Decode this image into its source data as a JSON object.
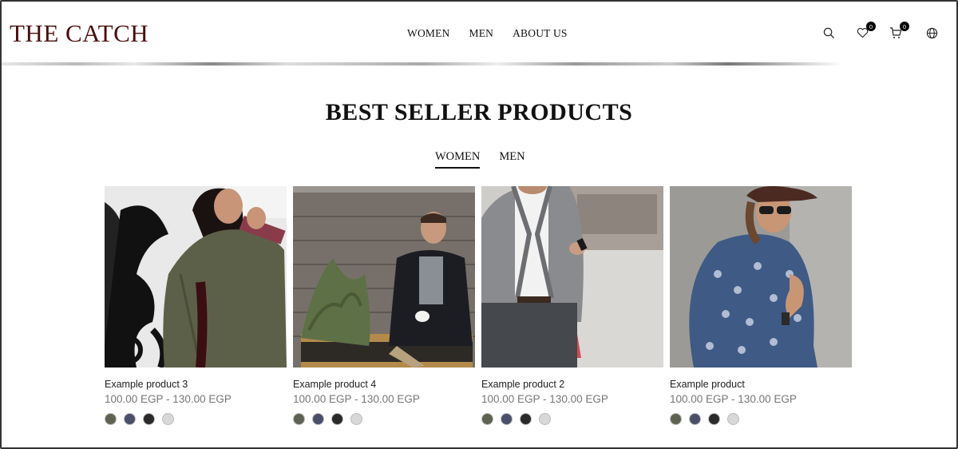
{
  "brand": {
    "logo_text": "THE CATCH",
    "color": "#4a0e0e"
  },
  "nav": {
    "items": [
      "WOMEN",
      "MEN",
      "ABOUT US"
    ]
  },
  "header_icons": {
    "wishlist_count": "0",
    "cart_count": "0"
  },
  "section": {
    "title": "BEST SELLER PRODUCTS",
    "tabs": [
      "WOMEN",
      "MEN"
    ],
    "active_tab": "WOMEN"
  },
  "products": [
    {
      "name": "Example product 3",
      "price": "100.00 EGP - 130.00 EGP"
    },
    {
      "name": "Example product 4",
      "price": "100.00 EGP - 130.00 EGP"
    },
    {
      "name": "Example product 2",
      "price": "100.00 EGP - 130.00 EGP"
    },
    {
      "name": "Example product",
      "price": "100.00 EGP - 130.00 EGP"
    }
  ]
}
